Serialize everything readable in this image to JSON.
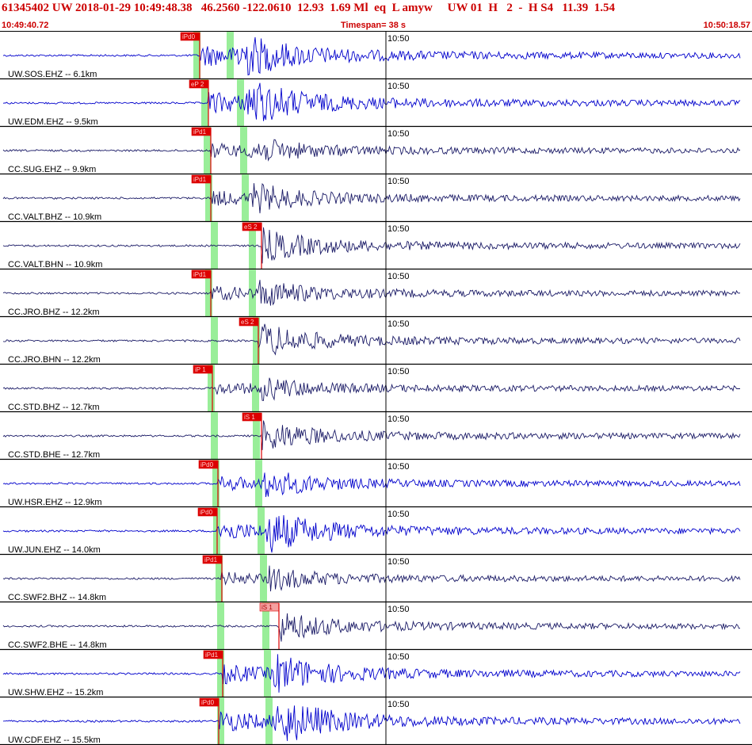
{
  "header": {
    "title": "61345402 UW 2018-01-29 10:49:48.38   46.2560 -122.0610  12.93  1.69 Ml  eq  L amyw     UW 01  H   2  -  H S4   11.39  1.54",
    "start_time": "10:49:40.72",
    "timespan": "Timespan=  38 s",
    "end_time": "10:50:18.57"
  },
  "colors": {
    "header_text": "#cc0000",
    "trace_uw": "#0000cc",
    "trace_cc": "#1a1a66",
    "pick_box": "#dd0000",
    "pick_box_light": "#f4a0a0",
    "pick_line": "#dd0000",
    "predicted_band": "#99ee99",
    "separator": "#000000"
  },
  "chart_data": {
    "type": "line",
    "title": "",
    "time_window": {
      "start": "10:49:40.72",
      "end": "10:50:18.57",
      "span_s": 38
    },
    "minute_marker": {
      "label": "10:50"
    },
    "traces": [
      {
        "label": "UW.SOS.EHZ -- 6.1km",
        "network": "UW",
        "pick": "iPd0",
        "pick_style": "solid",
        "amp": 1.0
      },
      {
        "label": "UW.EDM.EHZ -- 9.5km",
        "network": "UW",
        "pick": "eP 2",
        "pick_style": "solid",
        "amp": 1.0
      },
      {
        "label": "CC.SUG.EHZ -- 9.9km",
        "network": "CC",
        "pick": "iPd1",
        "pick_style": "solid",
        "amp": 0.55
      },
      {
        "label": "CC.VALT.BHZ -- 10.9km",
        "network": "CC",
        "pick": "iPd1",
        "pick_style": "solid",
        "amp": 0.6
      },
      {
        "label": "CC.VALT.BHN -- 10.9km",
        "network": "CC",
        "pick": "eS 2",
        "pick_style": "solid",
        "amp": 0.7
      },
      {
        "label": "CC.JRO.BHZ -- 12.2km",
        "network": "CC",
        "pick": "iPd1",
        "pick_style": "solid",
        "amp": 0.55
      },
      {
        "label": "CC.JRO.BHN -- 12.2km",
        "network": "CC",
        "pick": "eS 2",
        "pick_style": "solid",
        "amp": 0.65
      },
      {
        "label": "CC.STD.BHZ -- 12.7km",
        "network": "CC",
        "pick": "iP 1",
        "pick_style": "solid",
        "amp": 0.45
      },
      {
        "label": "CC.STD.BHE -- 12.7km",
        "network": "CC",
        "pick": "iS 1",
        "pick_style": "solid",
        "amp": 0.6
      },
      {
        "label": "UW.HSR.EHZ -- 12.9km",
        "network": "UW",
        "pick": "iPd0",
        "pick_style": "solid",
        "amp": 0.55
      },
      {
        "label": "UW.JUN.EHZ -- 14.0km",
        "network": "UW",
        "pick": "iPd0",
        "pick_style": "solid",
        "amp": 0.85
      },
      {
        "label": "CC.SWF2.BHZ -- 14.8km",
        "network": "CC",
        "pick": "iPd1",
        "pick_style": "solid",
        "amp": 0.45
      },
      {
        "label": "CC.SWF2.BHE -- 14.8km",
        "network": "CC",
        "pick": "iS 1",
        "pick_style": "light",
        "amp": 0.65
      },
      {
        "label": "UW.SHW.EHZ -- 15.2km",
        "network": "UW",
        "pick": "iPd1",
        "pick_style": "solid",
        "amp": 0.8
      },
      {
        "label": "UW.CDF.EHZ -- 15.5km",
        "network": "UW",
        "pick": "iPd0",
        "pick_style": "solid",
        "amp": 1.0
      }
    ]
  }
}
